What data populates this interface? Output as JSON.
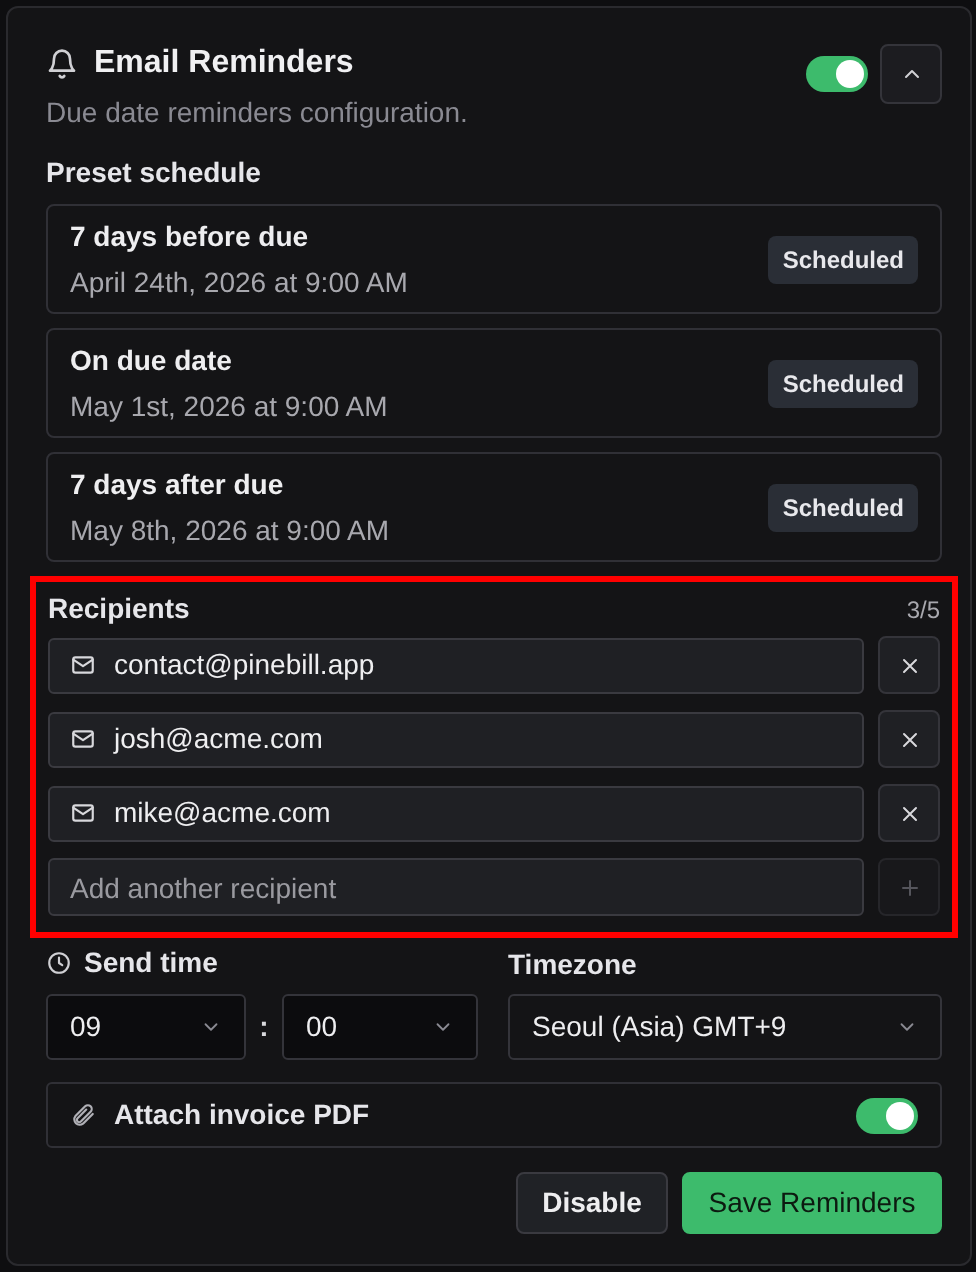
{
  "header": {
    "title": "Email Reminders",
    "subtitle": "Due date reminders configuration.",
    "enabled": true,
    "expanded": true
  },
  "preset_schedule": {
    "label": "Preset schedule",
    "items": [
      {
        "title": "7 days before due",
        "date": "April 24th, 2026 at 9:00 AM",
        "badge": "Scheduled"
      },
      {
        "title": "On due date",
        "date": "May 1st, 2026 at 9:00 AM",
        "badge": "Scheduled"
      },
      {
        "title": "7 days after due",
        "date": "May 8th, 2026 at 9:00 AM",
        "badge": "Scheduled"
      }
    ]
  },
  "recipients": {
    "label": "Recipients",
    "count": "3/5",
    "highlighted": true,
    "items": [
      {
        "email": "contact@pinebill.app"
      },
      {
        "email": "josh@acme.com"
      },
      {
        "email": "mike@acme.com"
      }
    ],
    "add_placeholder": "Add another recipient"
  },
  "send_time": {
    "label": "Send time",
    "hour": "09",
    "separator": ":",
    "minute": "00"
  },
  "timezone": {
    "label": "Timezone",
    "value": "Seoul (Asia) GMT+9"
  },
  "attach_pdf": {
    "label": "Attach invoice PDF",
    "on": true
  },
  "buttons": [
    {
      "kind": "secondary",
      "label": "Disable"
    },
    {
      "kind": "primary",
      "label": "Save Reminders"
    }
  ]
}
